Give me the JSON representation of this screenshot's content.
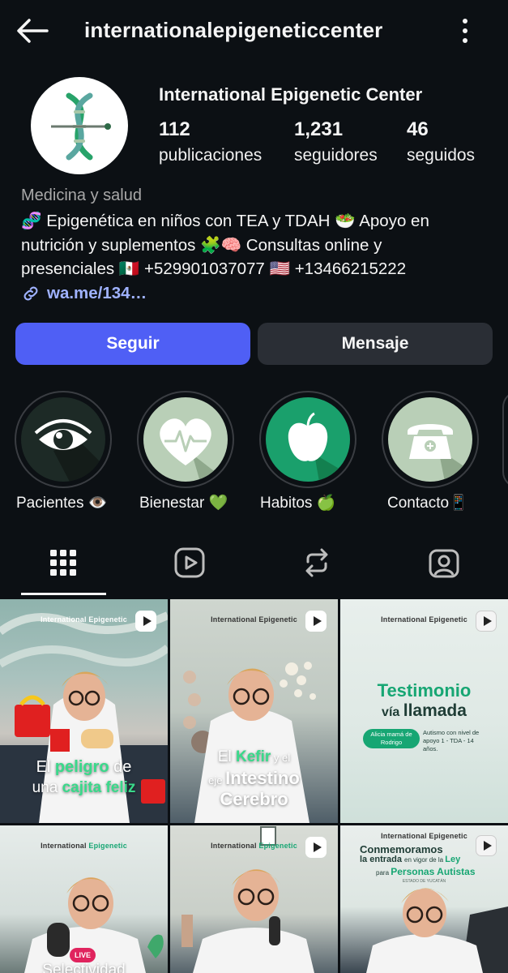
{
  "header": {
    "username": "internationalepigeneticcenter"
  },
  "profile": {
    "full_name": "International Epigenetic Center",
    "stats": [
      {
        "value": "112",
        "label": "publicaciones"
      },
      {
        "value": "1,231",
        "label": "seguidores"
      },
      {
        "value": "46",
        "label": "seguidos"
      }
    ],
    "category": "Medicina y salud",
    "bio_line1": "🧬 Epigenética en niños con TEA y TDAH 🥗 Apoyo en",
    "bio_line2": "nutrición y suplementos 🧩🧠 Consultas online y",
    "bio_line3": "presenciales 🇲🇽 +529901037077 🇺🇸 +13466215222",
    "link": "wa.me/134…"
  },
  "actions": {
    "follow_label": "Seguir",
    "message_label": "Mensaje",
    "follow_color": "#4f5ff5"
  },
  "highlights": [
    {
      "label": "Pacientes 👁️",
      "icon": "eye-icon"
    },
    {
      "label": "Bienestar 💚",
      "icon": "heart-pulse-icon"
    },
    {
      "label": "Habitos 🍏",
      "icon": "apple-icon"
    },
    {
      "label": "Contacto📱",
      "icon": "telephone-icon"
    }
  ],
  "tabs": [
    {
      "name": "grid",
      "icon": "grid-icon",
      "active": true
    },
    {
      "name": "reels",
      "icon": "reels-icon",
      "active": false
    },
    {
      "name": "reposts",
      "icon": "repost-icon",
      "active": false
    },
    {
      "name": "tagged",
      "icon": "tagged-icon",
      "active": false
    }
  ],
  "posts": [
    {
      "brand_a": "International ",
      "brand_b": "Epigenetic",
      "line1a": "El ",
      "line1b": "peligro",
      "line1c": " de",
      "line2a": "una ",
      "line2b": "cajita feliz"
    },
    {
      "brand_a": "International ",
      "brand_b": "Epigenetic",
      "line1a": "El ",
      "line1b": "Kefir",
      "line1c": " y el",
      "line2a": "eje ",
      "line2b": "Intestino",
      "line3": "Cerebro"
    },
    {
      "brand_a": "International ",
      "brand_b": "Epigenetic",
      "title1": "Testimonio",
      "title2a": "vía ",
      "title2b": "llamada",
      "pill": "Alicia mamá de Rodrigo",
      "note": "Autismo con nivel de apoyo 1 - TDA - 14 años."
    },
    {
      "brand_a": "International ",
      "brand_b": "Epigenetic",
      "live": "LIVE",
      "caption": "Selectividad"
    },
    {
      "brand_a": "International ",
      "brand_b": "Epigenetic"
    },
    {
      "brand_a": "International ",
      "brand_b": "Epigenetic",
      "title1a": "Conmemoramos",
      "title2a": "la entrada ",
      "title2b": "en vigor de la ",
      "title2c": "Ley",
      "title3a": "para ",
      "title3b": "Personas Autistas",
      "sub": "ESTADO DE YUCATÁN"
    }
  ]
}
